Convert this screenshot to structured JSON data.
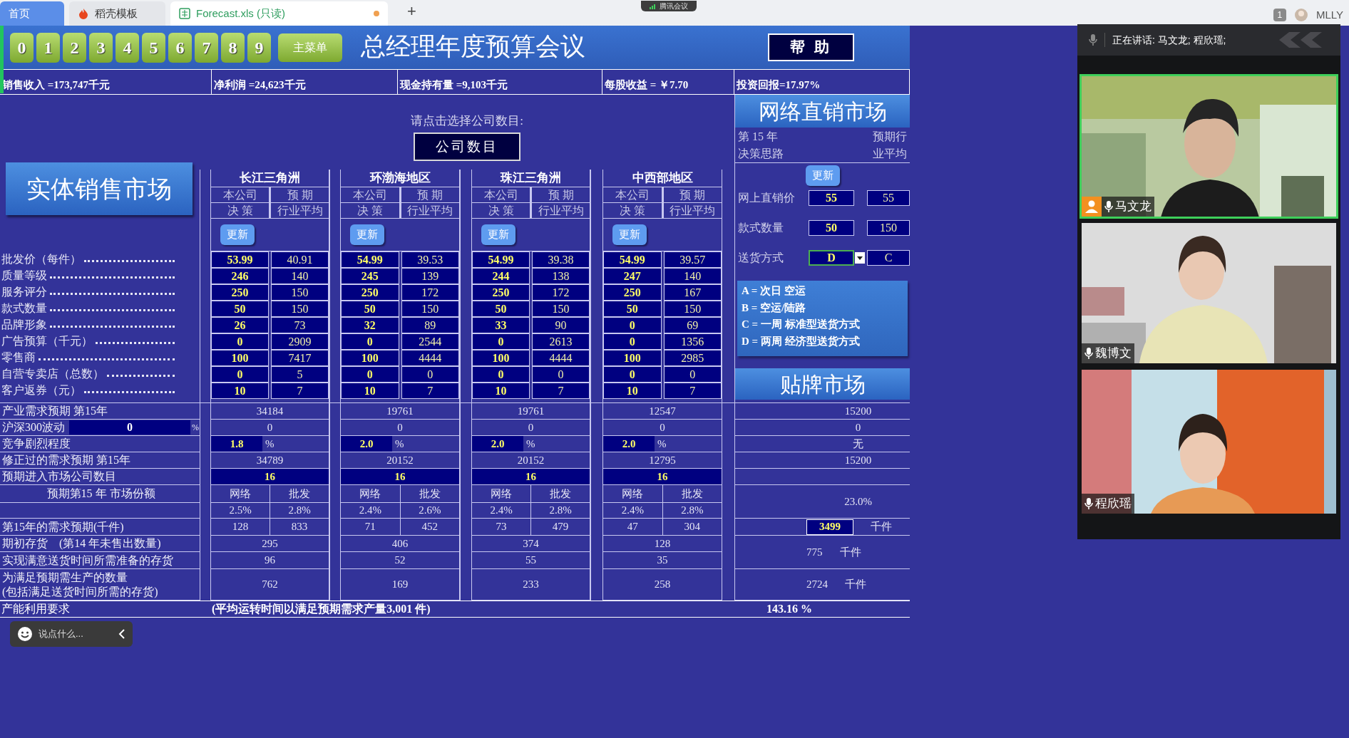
{
  "tabs": [
    {
      "label": "首页",
      "kind": "home",
      "selected": false,
      "modified": false
    },
    {
      "label": "稻壳模板",
      "kind": "docer",
      "selected": false,
      "modified": false
    },
    {
      "label": "Forecast.xls (只读)",
      "kind": "sheet",
      "selected": true,
      "modified": true
    }
  ],
  "new_tab": "+",
  "meeting_badge": "腾讯会议",
  "account": {
    "count": "1",
    "name": "MLLY"
  },
  "sheet": {
    "digit_buttons": [
      "0",
      "1",
      "2",
      "3",
      "4",
      "5",
      "6",
      "7",
      "8",
      "9"
    ],
    "menu_button": "主菜单",
    "title": "总经理年度预算会议",
    "help_button": "帮 助",
    "kpis": [
      "销售收入 =173,747千元",
      "净利润 =24,623千元",
      "现金持有量 =9,103千元",
      "每股收益 = ￥7.70",
      "投资回报=17.97%"
    ],
    "company_prompt": "请点击选择公司数目:",
    "company_button": "公司数目",
    "physical_market_button": "实体销售市场",
    "row_labels": [
      "批发价（每件）",
      "质量等级",
      "服务评分",
      "款式数量",
      "品牌形象",
      "广告预算（千元）",
      "零售商",
      "自营专卖店（总数）",
      "客户返券（元）"
    ],
    "markets": [
      {
        "name": "长江三角洲",
        "col_a": [
          "本公司",
          "决 策"
        ],
        "col_b": [
          "预 期",
          "行业平均"
        ],
        "update_button": "更新",
        "decision": [
          "53.99",
          "246",
          "250",
          "50",
          "26",
          "0",
          "100",
          "0",
          "10"
        ],
        "average": [
          "40.91",
          "140",
          "150",
          "150",
          "73",
          "2909",
          "7417",
          "5",
          "7"
        ]
      },
      {
        "name": "环渤海地区",
        "col_a": [
          "本公司",
          "决 策"
        ],
        "col_b": [
          "预 期",
          "行业平均"
        ],
        "update_button": "更新",
        "decision": [
          "54.99",
          "245",
          "250",
          "50",
          "32",
          "0",
          "100",
          "0",
          "10"
        ],
        "average": [
          "39.53",
          "139",
          "172",
          "150",
          "89",
          "2544",
          "4444",
          "0",
          "7"
        ]
      },
      {
        "name": "珠江三角洲",
        "col_a": [
          "本公司",
          "决 策"
        ],
        "col_b": [
          "预 期",
          "行业平均"
        ],
        "update_button": "更新",
        "decision": [
          "54.99",
          "244",
          "250",
          "50",
          "33",
          "0",
          "100",
          "0",
          "10"
        ],
        "average": [
          "39.38",
          "138",
          "172",
          "150",
          "90",
          "2613",
          "4444",
          "0",
          "7"
        ]
      },
      {
        "name": "中西部地区",
        "col_a": [
          "本公司",
          "决 策"
        ],
        "col_b": [
          "预 期",
          "行业平均"
        ],
        "update_button": "更新",
        "decision": [
          "54.99",
          "247",
          "250",
          "50",
          "0",
          "0",
          "100",
          "0",
          "10"
        ],
        "average": [
          "39.57",
          "140",
          "167",
          "150",
          "69",
          "1356",
          "2985",
          "0",
          "7"
        ]
      }
    ],
    "lower_rows": [
      {
        "kind": "plain",
        "label": "产业需求预期 第15年",
        "values": [
          "34184",
          "19761",
          "19761",
          "12547"
        ]
      },
      {
        "kind": "plain",
        "label": "沪深300波动",
        "input": "0",
        "unit": "%",
        "values": [
          "0",
          "0",
          "0",
          "0"
        ]
      },
      {
        "kind": "input_percent",
        "label": "竞争剧烈程度",
        "unit": "%",
        "values": [
          "1.8",
          "2.0",
          "2.0",
          "2.0"
        ]
      },
      {
        "kind": "plain",
        "label": "修正过的需求预期 第15年",
        "values": [
          "34789",
          "20152",
          "20152",
          "12795"
        ]
      },
      {
        "kind": "highlight",
        "label": "预期进入市场公司数目",
        "values": [
          "16",
          "16",
          "16",
          "16"
        ]
      },
      {
        "kind": "split",
        "label": "预期第15 年 市场份额",
        "values": [
          [
            "网络",
            "批发"
          ],
          [
            "网络",
            "批发"
          ],
          [
            "网络",
            "批发"
          ],
          [
            "网络",
            "批发"
          ]
        ]
      },
      {
        "kind": "split",
        "values": [
          [
            "2.5%",
            "2.8%"
          ],
          [
            "2.4%",
            "2.6%"
          ],
          [
            "2.4%",
            "2.8%"
          ],
          [
            "2.4%",
            "2.8%"
          ]
        ]
      },
      {
        "kind": "split",
        "label": "第15年的需求预期(千件)",
        "values": [
          [
            "128",
            "833"
          ],
          [
            "71",
            "452"
          ],
          [
            "73",
            "479"
          ],
          [
            "47",
            "304"
          ]
        ]
      },
      {
        "kind": "plain",
        "label": "期初存货　(第14 年未售出数量)",
        "values": [
          "295",
          "406",
          "374",
          "128"
        ]
      },
      {
        "kind": "plain",
        "label": "实现满意送货时间所需准备的存货",
        "values": [
          "96",
          "52",
          "55",
          "35"
        ]
      },
      {
        "kind": "plain",
        "label": "为满足预期需生产的数量",
        "label_2": "(包括满足送货时间所需的存货)",
        "values": [
          "762",
          "169",
          "233",
          "258"
        ]
      }
    ],
    "capacity_row": {
      "label": "产能利用要求",
      "note": "(平均运转时间以满足预期需求产量3,001 件)",
      "value": "143.16 %"
    },
    "online_market": {
      "title": "网络直销市场",
      "year_label": "第 15 年",
      "strategy_label": "决策思路",
      "avg_label": [
        "预期行",
        "业平均"
      ],
      "update_button": "更新",
      "fields": [
        {
          "label": "网上直销价",
          "kind": "number",
          "decision": "55",
          "average": "55"
        },
        {
          "label": "款式数量",
          "kind": "number",
          "decision": "50",
          "average": "150"
        },
        {
          "label": "送货方式",
          "kind": "dropdown",
          "decision": "D",
          "average": "C"
        }
      ],
      "legend": [
        "A = 次日 空运",
        "B = 空运/陆路",
        "C = 一周 标准型送货方式",
        "D = 两周 经济型送货方式"
      ]
    },
    "oem_market": {
      "title": "贴牌市场",
      "cells": [
        {
          "kind": "single",
          "value": "15200"
        },
        {
          "kind": "single",
          "value": "0"
        },
        {
          "kind": "single",
          "value": "无"
        },
        {
          "kind": "single",
          "value": "15200"
        },
        {
          "kind": "blank"
        },
        {
          "kind": "double",
          "value": "23.0%"
        },
        {
          "kind": "highlight",
          "value": "3499",
          "unit": "千件"
        },
        {
          "kind": "double",
          "value": "775",
          "unit": "千件"
        },
        {
          "kind": "single",
          "value": "2724",
          "unit": "千件"
        }
      ]
    }
  },
  "meeting": {
    "status": "正在讲话: 马文龙; 程欣瑶;",
    "participants": [
      {
        "name": "马文龙",
        "host": true,
        "speaking": true
      },
      {
        "name": "魏博文",
        "host": false,
        "speaking": false
      },
      {
        "name": "程欣瑶",
        "host": false,
        "speaking": false
      }
    ]
  },
  "chat_bar": {
    "placeholder": "说点什么..."
  }
}
